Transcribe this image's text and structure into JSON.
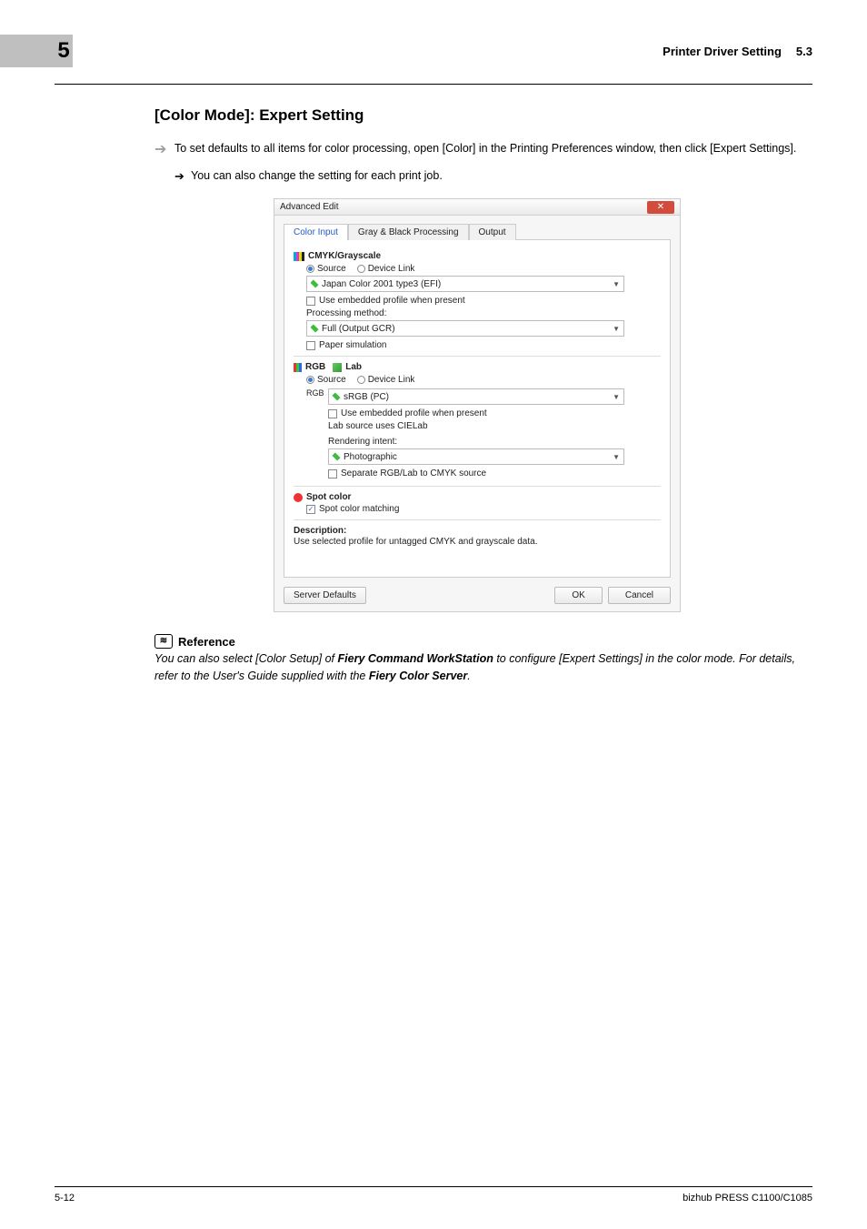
{
  "header": {
    "chapter": "5",
    "title": "Printer Driver Setting",
    "section_number": "5.3"
  },
  "section": {
    "heading": "[Color Mode]: Expert Setting",
    "intro": "To set defaults to all items for color processing, open [Color] in the Printing Preferences window, then click [Expert Settings].",
    "sub": "You can also change the setting for each print job."
  },
  "dialog": {
    "title": "Advanced Edit",
    "tabs": [
      "Color Input",
      "Gray & Black Processing",
      "Output"
    ],
    "cmyk": {
      "header": "CMYK/Grayscale",
      "radios": {
        "source": "Source",
        "device": "Device Link"
      },
      "select1": "Japan Color 2001 type3 (EFI)",
      "cb1": "Use embedded profile when present",
      "label1": "Processing method:",
      "select2": "Full (Output GCR)",
      "cb2": "Paper simulation"
    },
    "rgb": {
      "header": "RGB",
      "lab": "Lab",
      "radios": {
        "source": "Source",
        "device": "Device Link"
      },
      "side": "RGB",
      "select1": "sRGB (PC)",
      "cb1": "Use embedded profile when present",
      "lab_note": "Lab source uses CIELab",
      "label1": "Rendering intent:",
      "select2": "Photographic",
      "cb2": "Separate RGB/Lab to CMYK source"
    },
    "spot": {
      "header": "Spot color",
      "cb": "Spot color matching"
    },
    "description": {
      "label": "Description:",
      "text": "Use selected profile for untagged CMYK and grayscale data."
    },
    "footer": {
      "server_defaults": "Server Defaults",
      "ok": "OK",
      "cancel": "Cancel"
    }
  },
  "reference": {
    "icon_glyph": "≋",
    "head": "Reference",
    "text_parts": {
      "p1": "You can also select [Color Setup] of ",
      "b1": "Fiery Command WorkStation",
      "p2": " to configure [Expert Settings] in the color mode. For details, refer to the User's Guide supplied with the ",
      "b2": "Fiery Color Server",
      "p3": "."
    }
  },
  "footer": {
    "page": "5-12",
    "product": "bizhub PRESS C1100/C1085"
  }
}
